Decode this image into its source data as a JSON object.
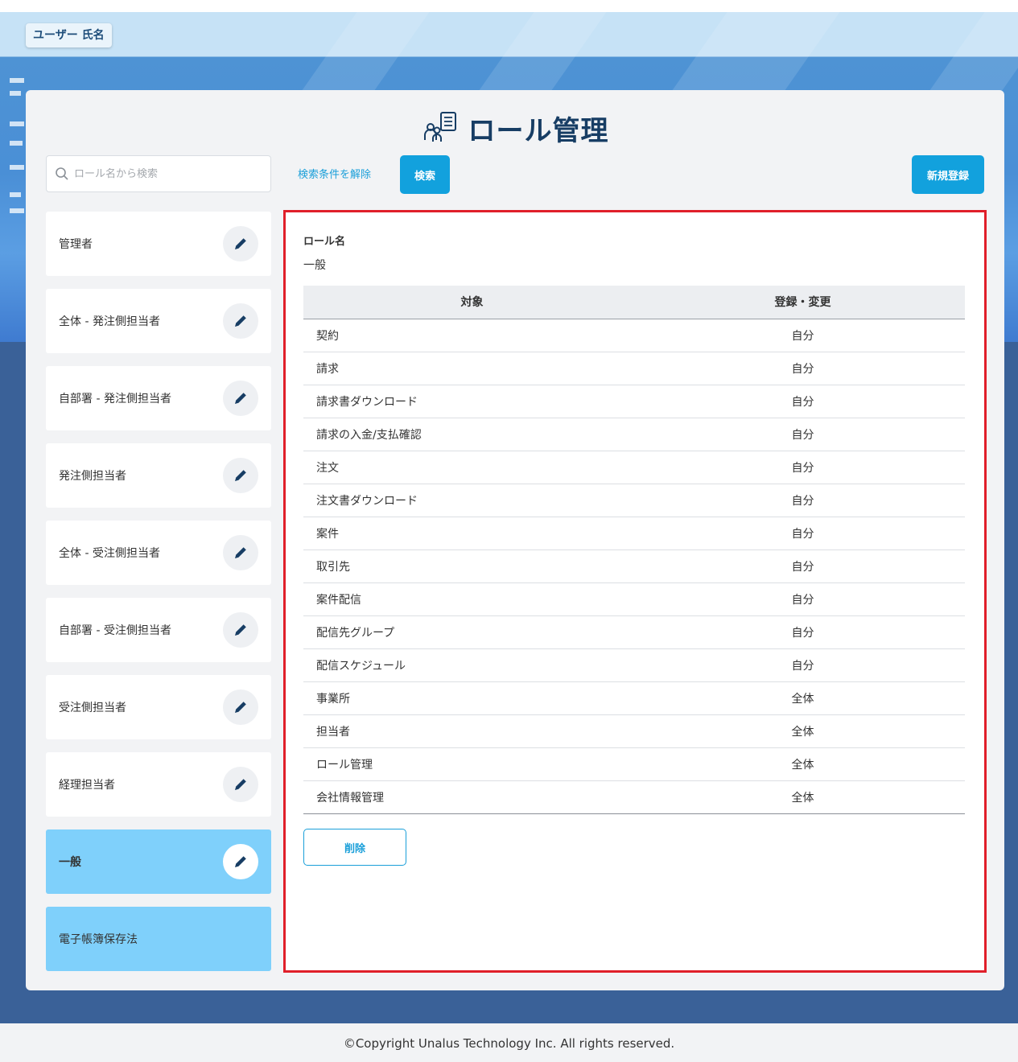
{
  "header": {
    "user_name": "ユーザー 氏名"
  },
  "page": {
    "title": "ロール管理"
  },
  "search": {
    "placeholder": "ロール名から検索",
    "value": "",
    "clear_label": "検索条件を解除",
    "submit_label": "検索"
  },
  "actions": {
    "new_label": "新規登録",
    "delete_label": "削除"
  },
  "roles": [
    {
      "label": "管理者",
      "selected": false
    },
    {
      "label": "全体 - 発注側担当者",
      "selected": false
    },
    {
      "label": "自部署 - 発注側担当者",
      "selected": false
    },
    {
      "label": "発注側担当者",
      "selected": false
    },
    {
      "label": "全体 - 受注側担当者",
      "selected": false
    },
    {
      "label": "自部署 - 受注側担当者",
      "selected": false
    },
    {
      "label": "受注側担当者",
      "selected": false
    },
    {
      "label": "経理担当者",
      "selected": false
    },
    {
      "label": "一般",
      "selected": true
    },
    {
      "label": "電子帳簿保存法",
      "selected": false
    }
  ],
  "detail": {
    "role_name_label": "ロール名",
    "role_name_value": "一般",
    "columns": [
      "対象",
      "登録・変更"
    ],
    "rows": [
      {
        "target": "契約",
        "scope": "自分"
      },
      {
        "target": "請求",
        "scope": "自分"
      },
      {
        "target": "請求書ダウンロード",
        "scope": "自分"
      },
      {
        "target": "請求の入金/支払確認",
        "scope": "自分"
      },
      {
        "target": "注文",
        "scope": "自分"
      },
      {
        "target": "注文書ダウンロード",
        "scope": "自分"
      },
      {
        "target": "案件",
        "scope": "自分"
      },
      {
        "target": "取引先",
        "scope": "自分"
      },
      {
        "target": "案件配信",
        "scope": "自分"
      },
      {
        "target": "配信先グループ",
        "scope": "自分"
      },
      {
        "target": "配信スケジュール",
        "scope": "自分"
      },
      {
        "target": "事業所",
        "scope": "全体"
      },
      {
        "target": "担当者",
        "scope": "全体"
      },
      {
        "target": "ロール管理",
        "scope": "全体"
      },
      {
        "target": "会社情報管理",
        "scope": "全体"
      }
    ]
  },
  "footer": {
    "copyright": "©Copyright Unalus Technology Inc. All rights reserved."
  },
  "colors": {
    "accent": "#12a1dd",
    "selected_role": "#7fd0fb",
    "highlight_border": "#e01f2a",
    "title": "#173d64",
    "background": "#3a6198"
  },
  "icons": {
    "title": "role-management-icon",
    "search": "search-icon",
    "edit": "pencil-icon"
  }
}
